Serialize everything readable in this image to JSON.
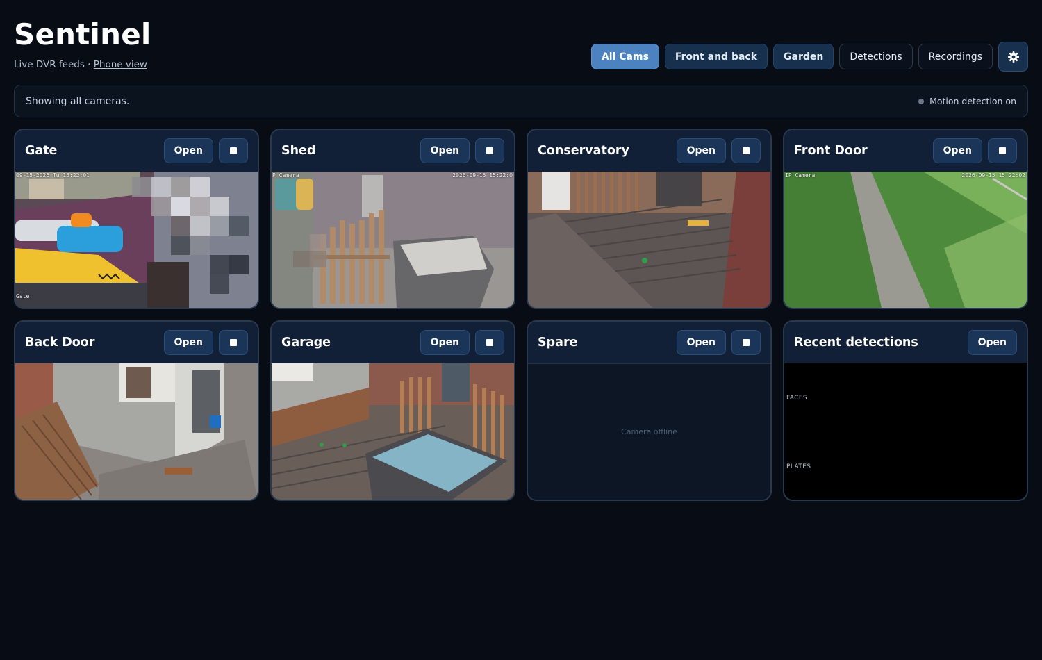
{
  "app": {
    "title": "Sentinel",
    "subtitle": "Live DVR feeds ·",
    "subtitle_link": "Phone view"
  },
  "nav": {
    "all_cams": "All Cams",
    "front_and_back": "Front and back",
    "garden": "Garden",
    "detections": "Detections",
    "recordings": "Recordings",
    "settings_icon": "gear-icon"
  },
  "status": {
    "message": "Showing all cameras.",
    "motion": "Motion detection on",
    "motion_dot_color": "#6b7888"
  },
  "cameras": [
    {
      "name": "Gate",
      "open": "Open",
      "osd_tl": "09-15-2026 Tu 15:22:01",
      "osd_bl": "Gate"
    },
    {
      "name": "Shed",
      "open": "Open",
      "osd_tl": "P Camera",
      "osd_tr": "2026-09-15 15:22:0"
    },
    {
      "name": "Conservatory",
      "open": "Open"
    },
    {
      "name": "Front Door",
      "open": "Open",
      "osd_tl": "IP Camera",
      "osd_tr": "2026-09-15 15:22:02"
    },
    {
      "name": "Back Door",
      "open": "Open"
    },
    {
      "name": "Garage",
      "open": "Open"
    },
    {
      "name": "Spare",
      "open": "Open",
      "offline": "Camera offline"
    }
  ],
  "detections_panel": {
    "title": "Recent detections",
    "open": "Open",
    "faces_label": "FACES",
    "plates_label": "PLATES"
  },
  "colors": {
    "background": "#070c15",
    "accent": "#4b82bf",
    "button_dark": "#17304d"
  }
}
